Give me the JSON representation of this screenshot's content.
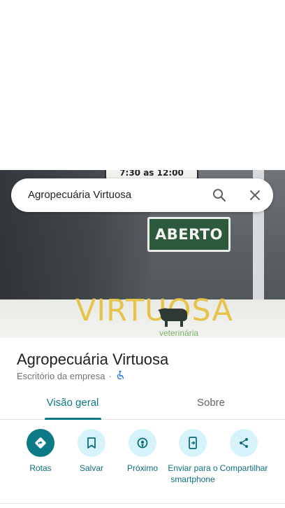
{
  "search": {
    "query": "Agropecuária Virtuosa"
  },
  "photo": {
    "hours_sign": "7:30 as 12:00",
    "open_sign": "ABERTO",
    "brand_text": "VIRTUOSA",
    "brand_sub": "veterinária"
  },
  "place": {
    "name": "Agropecuária Virtuosa",
    "category": "Escritório da empresa",
    "separator": "·"
  },
  "tabs": [
    {
      "label": "Visão geral",
      "active": true
    },
    {
      "label": "Sobre",
      "active": false
    }
  ],
  "actions": [
    {
      "label": "Rotas",
      "icon": "directions-icon"
    },
    {
      "label": "Salvar",
      "icon": "bookmark-icon"
    },
    {
      "label": "Próximo",
      "icon": "nearby-icon"
    },
    {
      "label": "Enviar para o smartphone",
      "icon": "send-to-phone-icon"
    },
    {
      "label": "Compartilhar",
      "icon": "share-icon"
    }
  ],
  "colors": {
    "accent": "#0b7a86",
    "action_bg": "#d6f3fb",
    "accessibility": "#1a73e8"
  }
}
